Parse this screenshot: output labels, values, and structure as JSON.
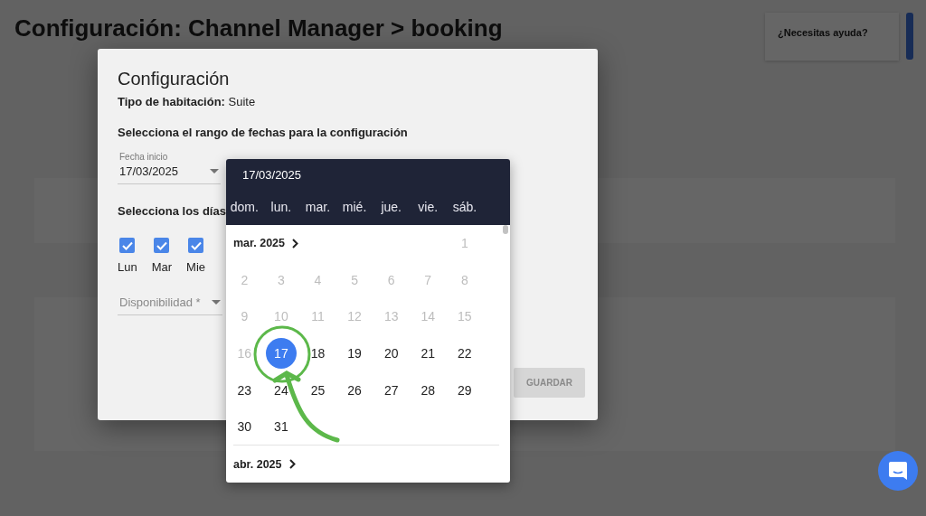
{
  "page": {
    "title": "Configuración: Channel Manager > booking",
    "help_title": "¿Necesitas ayuda?"
  },
  "dialog": {
    "title": "Configuración",
    "room_type": "**Tipo de habitación:** Suite",
    "range_heading": "Selecciona el rango de fechas para la configuración",
    "start_field": {
      "label": "Fecha inicio",
      "value": "17/03/2025"
    },
    "days_heading": "Selecciona los días",
    "weekdays": [
      {
        "label": "Lun",
        "checked": true
      },
      {
        "label": "Mar",
        "checked": true
      },
      {
        "label": "Mie",
        "checked": true
      }
    ],
    "availability": {
      "placeholder": "Disponibilidad *"
    },
    "save_button": {
      "label": "GUARDAR",
      "disabled": true
    }
  },
  "date_picker": {
    "selected_date": "17/03/2025",
    "weekday_names": [
      "dom.",
      "lun.",
      "mar.",
      "mié.",
      "jue.",
      "vie.",
      "sáb."
    ],
    "months": [
      {
        "label": "mar. 2025",
        "weeks": [
          [
            {
              "day": "1",
              "disabled": true,
              "selected": false
            }
          ],
          [
            {
              "day": "2",
              "disabled": true,
              "selected": false
            },
            {
              "day": "3",
              "disabled": true,
              "selected": false
            },
            {
              "day": "4",
              "disabled": true,
              "selected": false
            },
            {
              "day": "5",
              "disabled": true,
              "selected": false
            },
            {
              "day": "6",
              "disabled": true,
              "selected": false
            },
            {
              "day": "7",
              "disabled": true,
              "selected": false
            },
            {
              "day": "8",
              "disabled": true,
              "selected": false
            }
          ],
          [
            {
              "day": "9",
              "disabled": true,
              "selected": false
            },
            {
              "day": "10",
              "disabled": true,
              "selected": false
            },
            {
              "day": "11",
              "disabled": true,
              "selected": false
            },
            {
              "day": "12",
              "disabled": true,
              "selected": false
            },
            {
              "day": "13",
              "disabled": true,
              "selected": false
            },
            {
              "day": "14",
              "disabled": true,
              "selected": false
            },
            {
              "day": "15",
              "disabled": true,
              "selected": false
            }
          ],
          [
            {
              "day": "16",
              "disabled": true,
              "selected": false
            },
            {
              "day": "17",
              "disabled": false,
              "selected": true
            },
            {
              "day": "18",
              "disabled": false,
              "selected": false
            },
            {
              "day": "19",
              "disabled": false,
              "selected": false
            },
            {
              "day": "20",
              "disabled": false,
              "selected": false
            },
            {
              "day": "21",
              "disabled": false,
              "selected": false
            },
            {
              "day": "22",
              "disabled": false,
              "selected": false
            }
          ],
          [
            {
              "day": "23",
              "disabled": false,
              "selected": false
            },
            {
              "day": "24",
              "disabled": false,
              "selected": false
            },
            {
              "day": "25",
              "disabled": false,
              "selected": false
            },
            {
              "day": "26",
              "disabled": false,
              "selected": false
            },
            {
              "day": "27",
              "disabled": false,
              "selected": false
            },
            {
              "day": "28",
              "disabled": false,
              "selected": false
            },
            {
              "day": "29",
              "disabled": false,
              "selected": false
            }
          ],
          [
            {
              "day": "30",
              "disabled": false,
              "selected": false
            },
            {
              "day": "31",
              "disabled": false,
              "selected": false
            }
          ]
        ]
      },
      {
        "label": "abr. 2025"
      }
    ]
  }
}
